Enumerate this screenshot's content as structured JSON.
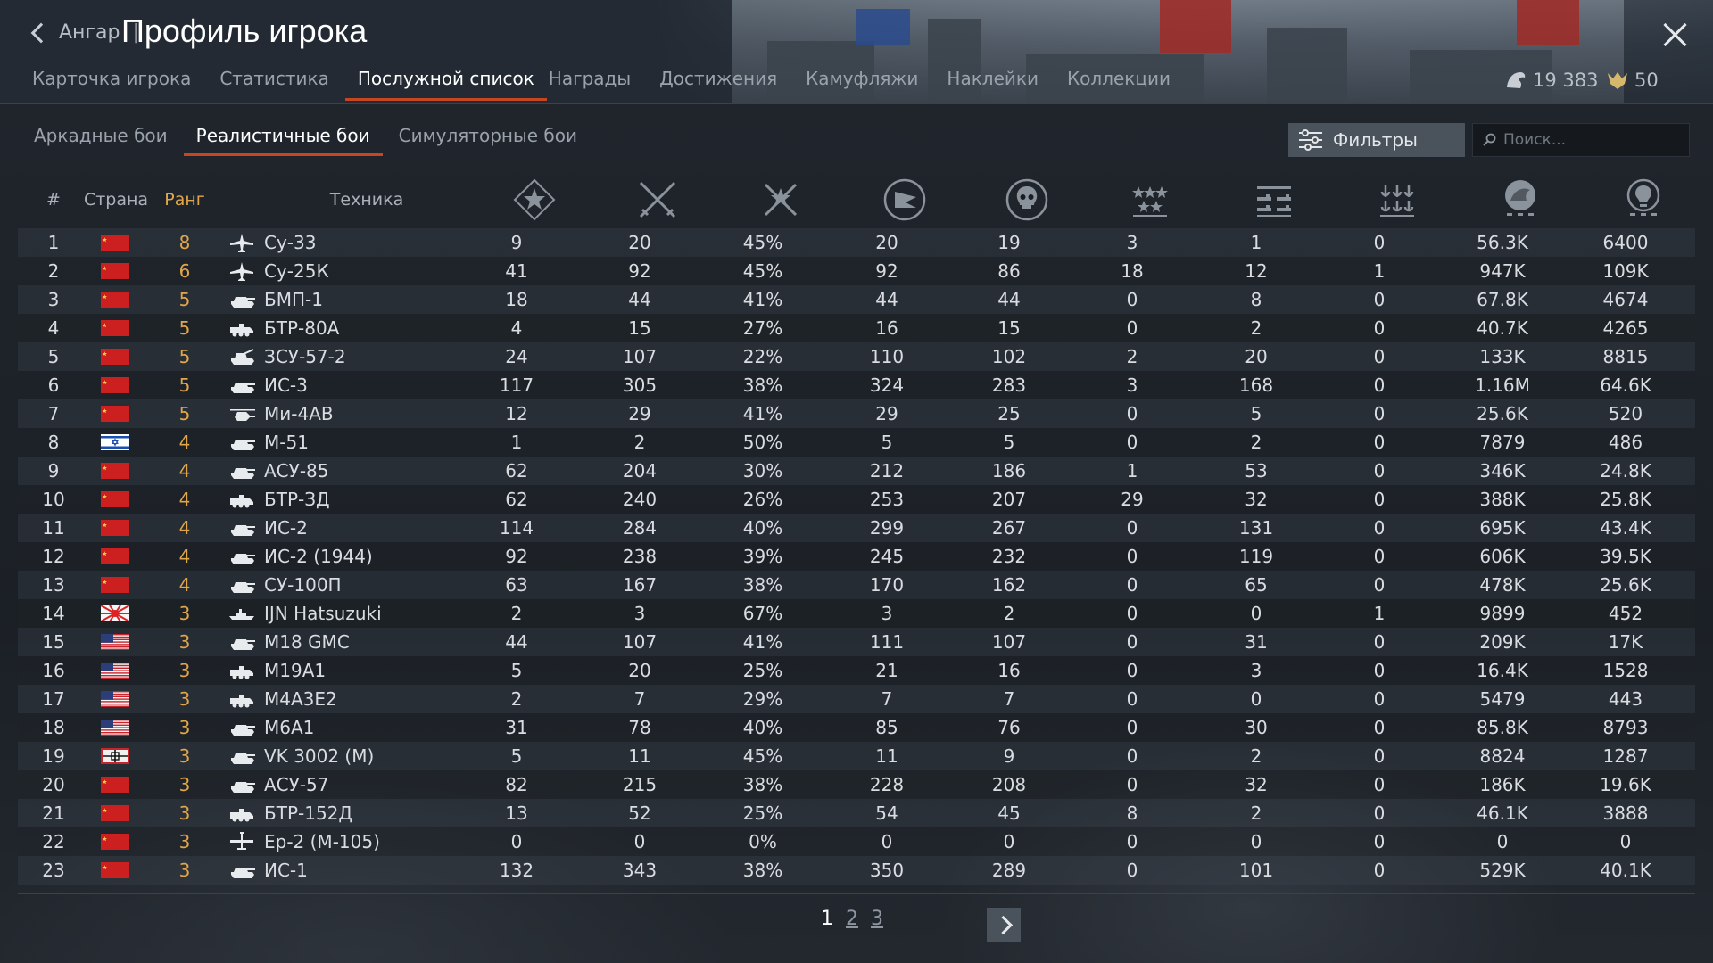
{
  "header": {
    "back_label": "Ангар",
    "title": "Профиль игрока",
    "tabs": [
      {
        "label": "Карточка игрока"
      },
      {
        "label": "Статистика"
      },
      {
        "label": "Послужной список"
      },
      {
        "label": "Награды"
      },
      {
        "label": "Достижения"
      },
      {
        "label": "Камуфляжи"
      },
      {
        "label": "Наклейки"
      },
      {
        "label": "Коллекции"
      }
    ],
    "active_tab": "Послужной список",
    "silver_lions": "19 383",
    "golden_eagles": "50"
  },
  "subtabs": [
    {
      "label": "Аркадные бои"
    },
    {
      "label": "Реалистичные бои"
    },
    {
      "label": "Симуляторные бои"
    }
  ],
  "active_subtab": "Реалистичные бои",
  "filters_label": "Фильтры",
  "search_placeholder": "Поиск...",
  "columns": {
    "num": "#",
    "country": "Страна",
    "rank": "Ранг",
    "vehicle": "Техника",
    "icon_columns": [
      "battles-icon",
      "deaths-icon",
      "win-ratio-icon",
      "respawns-icon",
      "kills-icon",
      "air-kills-icon",
      "ground-kills-icon",
      "naval-kills-icon",
      "silver-lions-earned-icon",
      "research-points-icon"
    ]
  },
  "rows": [
    {
      "n": "1",
      "flag": "ussr",
      "rank": "8",
      "type": "jet",
      "name": "Су-33",
      "c": [
        "9",
        "20",
        "45%",
        "20",
        "19",
        "3",
        "1",
        "0",
        "56.3K",
        "6400"
      ]
    },
    {
      "n": "2",
      "flag": "ussr",
      "rank": "6",
      "type": "jet",
      "name": "Су-25К",
      "c": [
        "41",
        "92",
        "45%",
        "92",
        "86",
        "18",
        "12",
        "1",
        "947K",
        "109K"
      ]
    },
    {
      "n": "3",
      "flag": "ussr",
      "rank": "5",
      "type": "tank",
      "name": "БМП-1",
      "c": [
        "18",
        "44",
        "41%",
        "44",
        "44",
        "0",
        "8",
        "0",
        "67.8K",
        "4674"
      ]
    },
    {
      "n": "4",
      "flag": "ussr",
      "rank": "5",
      "type": "apc",
      "name": "БТР-80А",
      "c": [
        "4",
        "15",
        "27%",
        "16",
        "15",
        "0",
        "2",
        "0",
        "40.7K",
        "4265"
      ]
    },
    {
      "n": "5",
      "flag": "ussr",
      "rank": "5",
      "type": "spaa",
      "name": "ЗСУ-57-2",
      "c": [
        "24",
        "107",
        "22%",
        "110",
        "102",
        "2",
        "20",
        "0",
        "133K",
        "8815"
      ]
    },
    {
      "n": "6",
      "flag": "ussr",
      "rank": "5",
      "type": "tank",
      "name": "ИС-3",
      "c": [
        "117",
        "305",
        "38%",
        "324",
        "283",
        "3",
        "168",
        "0",
        "1.16M",
        "64.6K"
      ]
    },
    {
      "n": "7",
      "flag": "ussr",
      "rank": "5",
      "type": "heli",
      "name": "Ми-4АВ",
      "c": [
        "12",
        "29",
        "41%",
        "29",
        "25",
        "0",
        "5",
        "0",
        "25.6K",
        "520"
      ]
    },
    {
      "n": "8",
      "flag": "israel",
      "rank": "4",
      "type": "tank",
      "name": "М-51",
      "c": [
        "1",
        "2",
        "50%",
        "5",
        "5",
        "0",
        "2",
        "0",
        "7879",
        "486"
      ]
    },
    {
      "n": "9",
      "flag": "ussr",
      "rank": "4",
      "type": "tank",
      "name": "АСУ-85",
      "c": [
        "62",
        "204",
        "30%",
        "212",
        "186",
        "1",
        "53",
        "0",
        "346K",
        "24.8K"
      ]
    },
    {
      "n": "10",
      "flag": "ussr",
      "rank": "4",
      "type": "apc",
      "name": "БТР-ЗД",
      "c": [
        "62",
        "240",
        "26%",
        "253",
        "207",
        "29",
        "32",
        "0",
        "388K",
        "25.8K"
      ]
    },
    {
      "n": "11",
      "flag": "ussr",
      "rank": "4",
      "type": "tank",
      "name": "ИС-2",
      "c": [
        "114",
        "284",
        "40%",
        "299",
        "267",
        "0",
        "131",
        "0",
        "695K",
        "43.4K"
      ]
    },
    {
      "n": "12",
      "flag": "ussr",
      "rank": "4",
      "type": "tank",
      "name": "ИС-2 (1944)",
      "c": [
        "92",
        "238",
        "39%",
        "245",
        "232",
        "0",
        "119",
        "0",
        "606K",
        "39.5K"
      ]
    },
    {
      "n": "13",
      "flag": "ussr",
      "rank": "4",
      "type": "tank",
      "name": "СУ-100П",
      "c": [
        "63",
        "167",
        "38%",
        "170",
        "162",
        "0",
        "65",
        "0",
        "478K",
        "25.6K"
      ]
    },
    {
      "n": "14",
      "flag": "japan",
      "rank": "3",
      "type": "ship",
      "name": "IJN Hatsuzuki",
      "c": [
        "2",
        "3",
        "67%",
        "3",
        "2",
        "0",
        "0",
        "1",
        "9899",
        "452"
      ]
    },
    {
      "n": "15",
      "flag": "usa",
      "rank": "3",
      "type": "tank",
      "name": "M18 GMC",
      "c": [
        "44",
        "107",
        "41%",
        "111",
        "107",
        "0",
        "31",
        "0",
        "209K",
        "17K"
      ]
    },
    {
      "n": "16",
      "flag": "usa",
      "rank": "3",
      "type": "apc",
      "name": "M19A1",
      "c": [
        "5",
        "20",
        "25%",
        "21",
        "16",
        "0",
        "3",
        "0",
        "16.4K",
        "1528"
      ]
    },
    {
      "n": "17",
      "flag": "usa",
      "rank": "3",
      "type": "apc",
      "name": "M4A3E2",
      "c": [
        "2",
        "7",
        "29%",
        "7",
        "7",
        "0",
        "0",
        "0",
        "5479",
        "443"
      ]
    },
    {
      "n": "18",
      "flag": "usa",
      "rank": "3",
      "type": "tank",
      "name": "M6A1",
      "c": [
        "31",
        "78",
        "40%",
        "85",
        "76",
        "0",
        "30",
        "0",
        "85.8K",
        "8793"
      ]
    },
    {
      "n": "19",
      "flag": "germany",
      "rank": "3",
      "type": "tank",
      "name": "VK 3002 (M)",
      "c": [
        "5",
        "11",
        "45%",
        "11",
        "9",
        "0",
        "2",
        "0",
        "8824",
        "1287"
      ]
    },
    {
      "n": "20",
      "flag": "ussr",
      "rank": "3",
      "type": "tank",
      "name": "АСУ-57",
      "c": [
        "82",
        "215",
        "38%",
        "228",
        "208",
        "0",
        "32",
        "0",
        "186K",
        "19.6K"
      ]
    },
    {
      "n": "21",
      "flag": "ussr",
      "rank": "3",
      "type": "apc",
      "name": "БТР-152Д",
      "c": [
        "13",
        "52",
        "25%",
        "54",
        "45",
        "8",
        "2",
        "0",
        "46.1K",
        "3888"
      ]
    },
    {
      "n": "22",
      "flag": "ussr",
      "rank": "3",
      "type": "prop",
      "name": "Ер-2 (М-105)",
      "c": [
        "0",
        "0",
        "0%",
        "0",
        "0",
        "0",
        "0",
        "0",
        "0",
        "0"
      ]
    },
    {
      "n": "23",
      "flag": "ussr",
      "rank": "3",
      "type": "tank",
      "name": "ИС-1",
      "c": [
        "132",
        "343",
        "38%",
        "350",
        "289",
        "0",
        "101",
        "0",
        "529K",
        "40.1K"
      ]
    }
  ],
  "pagination": {
    "pages": [
      "1",
      "2",
      "3"
    ],
    "current": "1"
  },
  "colors": {
    "accent": "#c6461f",
    "rank": "#e1a64a"
  }
}
